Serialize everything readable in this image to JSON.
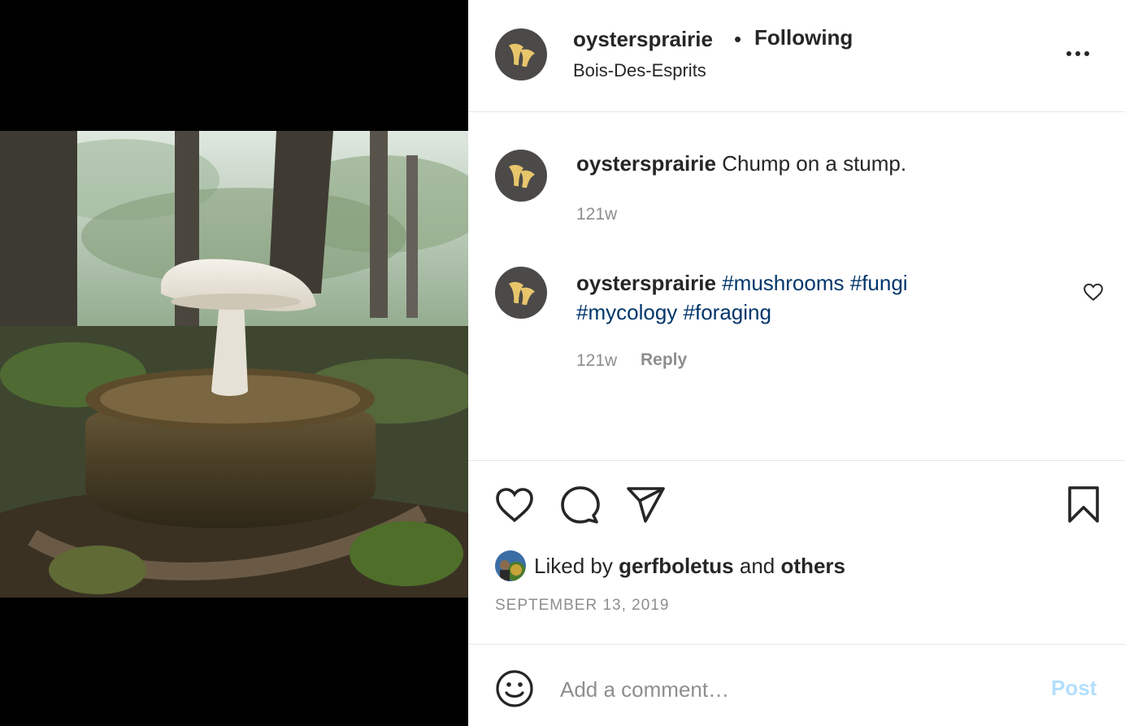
{
  "post": {
    "username": "oystersprairie",
    "separator": "•",
    "follow_status": "Following",
    "location": "Bois-Des-Esprits",
    "avatar_icon": "mushroom-logo-icon",
    "media_description_icon": "mushroom-on-stump-photo"
  },
  "comments": [
    {
      "username": "oystersprairie",
      "text": "Chump on a stump.",
      "time": "121w"
    },
    {
      "username": "oystersprairie",
      "tags": [
        "#mushrooms",
        "#fungi",
        "#mycology",
        "#foraging"
      ],
      "time": "121w",
      "reply_label": "Reply"
    }
  ],
  "actions": {
    "like_icon": "heart-icon",
    "comment_icon": "comment-bubble-icon",
    "share_icon": "paper-plane-icon",
    "save_icon": "bookmark-icon"
  },
  "likes": {
    "prefix": "Liked by",
    "user": "gerfboletus",
    "conjunction": "and",
    "others": "others"
  },
  "date": "SEPTEMBER 13, 2019",
  "add_comment": {
    "placeholder": "Add a comment…",
    "post_label": "Post"
  },
  "colors": {
    "hashtag": "#00376b",
    "post_button_disabled": "#b2dffc",
    "secondary_text": "#8e8e8e"
  }
}
